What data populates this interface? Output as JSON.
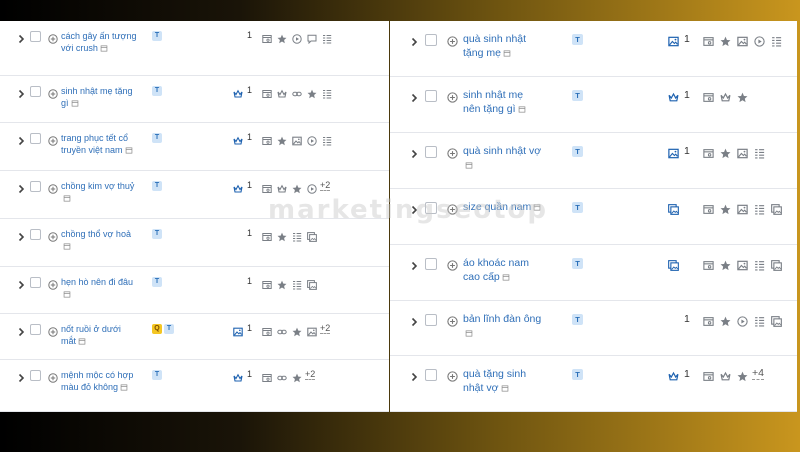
{
  "left_rows": [
    {
      "keyword": "cách gây ấn tượng với crush",
      "badges": [
        "T"
      ],
      "feature_count": "1",
      "count_icon": "none",
      "features": [
        "serp-icon",
        "star-icon",
        "video-icon",
        "comment-icon",
        "list-icon"
      ],
      "more": ""
    },
    {
      "keyword": "sinh nhật mẹ tặng gì",
      "badges": [
        "T"
      ],
      "feature_count": "1",
      "count_icon": "crown-icon",
      "features": [
        "serp-icon",
        "crown-icon",
        "link-icon",
        "star-icon",
        "list-icon"
      ],
      "more": ""
    },
    {
      "keyword": "trang phục tết cổ truyền việt nam",
      "badges": [
        "T"
      ],
      "feature_count": "1",
      "count_icon": "crown-icon",
      "features": [
        "serp-icon",
        "star-icon",
        "image-icon",
        "video-icon",
        "list-icon"
      ],
      "more": ""
    },
    {
      "keyword": "chồng kim vợ thuỷ",
      "badges": [
        "T"
      ],
      "feature_count": "1",
      "count_icon": "crown-icon",
      "features": [
        "serp-icon",
        "crown-icon",
        "star-icon",
        "video-icon"
      ],
      "more": "+2"
    },
    {
      "keyword": "chồng thổ vợ hoả",
      "badges": [
        "T"
      ],
      "feature_count": "1",
      "count_icon": "none",
      "features": [
        "serp-icon",
        "star-icon",
        "list-icon",
        "gallery-icon"
      ],
      "more": ""
    },
    {
      "keyword": "hẹn hò nên đi đâu",
      "badges": [
        "T"
      ],
      "feature_count": "1",
      "count_icon": "none",
      "features": [
        "serp-icon",
        "star-icon",
        "list-icon",
        "gallery-icon"
      ],
      "more": ""
    },
    {
      "keyword": "nốt ruồi ở dưới mắt",
      "badges": [
        "Q",
        "T"
      ],
      "feature_count": "1",
      "count_icon": "image-icon",
      "features": [
        "serp-icon",
        "link-icon",
        "star-icon",
        "image-icon"
      ],
      "more": "+2"
    },
    {
      "keyword": "mệnh mộc có hợp màu đỏ không",
      "badges": [
        "T"
      ],
      "feature_count": "1",
      "count_icon": "crown-icon",
      "features": [
        "serp-icon",
        "link-icon",
        "star-icon"
      ],
      "more": "+2"
    }
  ],
  "right_rows": [
    {
      "keyword": "quà sinh nhật tặng mẹ",
      "badges": [
        "T"
      ],
      "feature_count": "1",
      "count_icon": "image-icon",
      "features": [
        "serp-icon",
        "star-icon",
        "image-icon",
        "video-icon",
        "list-icon"
      ],
      "more": ""
    },
    {
      "keyword": "sinh nhật mẹ nên tặng gì",
      "badges": [
        "T"
      ],
      "feature_count": "1",
      "count_icon": "crown-icon",
      "features": [
        "serp-icon",
        "crown-icon",
        "star-icon"
      ],
      "more": ""
    },
    {
      "keyword": "quà sinh nhật vợ",
      "badges": [
        "T"
      ],
      "feature_count": "1",
      "count_icon": "image-icon",
      "features": [
        "serp-icon",
        "star-icon",
        "image-icon",
        "list-icon"
      ],
      "more": ""
    },
    {
      "keyword": "size quần nam",
      "badges": [
        "T"
      ],
      "feature_count": "",
      "count_icon": "gallery-icon",
      "features": [
        "serp-icon",
        "star-icon",
        "image-icon",
        "list-icon",
        "gallery-icon"
      ],
      "more": ""
    },
    {
      "keyword": "áo khoác nam cao cấp",
      "badges": [
        "T"
      ],
      "feature_count": "",
      "count_icon": "gallery-icon",
      "features": [
        "serp-icon",
        "star-icon",
        "image-icon",
        "list-icon",
        "gallery-icon"
      ],
      "more": ""
    },
    {
      "keyword": "bản lĩnh đàn ông",
      "badges": [
        "T"
      ],
      "feature_count": "1",
      "count_icon": "none",
      "features": [
        "serp-icon",
        "star-icon",
        "video-icon",
        "list-icon",
        "gallery-icon"
      ],
      "more": ""
    },
    {
      "keyword": "quà tặng sinh nhật vợ",
      "badges": [
        "T"
      ],
      "feature_count": "1",
      "count_icon": "crown-icon",
      "features": [
        "serp-icon",
        "crown-icon",
        "star-icon"
      ],
      "more": "+4"
    }
  ],
  "watermark": "marketingseotop",
  "colors": {
    "link": "#2f6fb8",
    "badge_bg": "#cfe3f7",
    "badge_q": "#f4c623",
    "icon_grey": "#7a7f86",
    "icon_blue": "#1e62b0"
  }
}
